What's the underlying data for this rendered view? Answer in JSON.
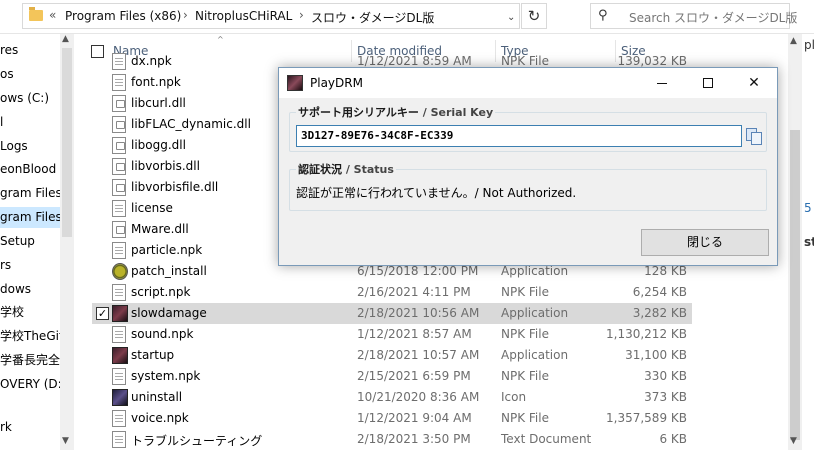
{
  "address": {
    "crumbs": [
      "Program Files (x86)",
      "NitroplusCHiRAL",
      "スロウ・ダメージDL版"
    ],
    "overflow": "«",
    "search_placeholder": "Search スロウ・ダメージDL版"
  },
  "nav": {
    "items": [
      "res",
      "os",
      "ows (C:)",
      "l",
      "Logs",
      "eonBlood",
      "gram Files",
      "gram Files (",
      "Setup",
      "rs",
      "dows",
      "学校",
      "学校TheGift",
      "学番長完全",
      "OVERY (D:)",
      "",
      "rk"
    ]
  },
  "columns": {
    "name": "Name",
    "date": "Date modified",
    "type": "Type",
    "size": "Size"
  },
  "files": [
    {
      "name": "dx.npk",
      "date": "1/12/2021 8:59 AM",
      "type": "NPK File",
      "size": "139,032 KB",
      "icon": "npk-icon",
      "checked": false
    },
    {
      "name": "font.npk",
      "date": "",
      "type": "",
      "size": "",
      "icon": "npk-icon",
      "checked": false
    },
    {
      "name": "libcurl.dll",
      "date": "",
      "type": "",
      "size": "",
      "icon": "dll-icon",
      "checked": false
    },
    {
      "name": "libFLAC_dynamic.dll",
      "date": "",
      "type": "",
      "size": "",
      "icon": "dll-icon",
      "checked": false
    },
    {
      "name": "libogg.dll",
      "date": "",
      "type": "",
      "size": "",
      "icon": "dll-icon",
      "checked": false
    },
    {
      "name": "libvorbis.dll",
      "date": "",
      "type": "",
      "size": "",
      "icon": "dll-icon",
      "checked": false
    },
    {
      "name": "libvorbisfile.dll",
      "date": "",
      "type": "",
      "size": "",
      "icon": "dll-icon",
      "checked": false
    },
    {
      "name": "license",
      "date": "",
      "type": "",
      "size": "",
      "icon": "text-file-icon",
      "checked": false
    },
    {
      "name": "Mware.dll",
      "date": "",
      "type": "",
      "size": "",
      "icon": "dll-icon",
      "checked": false
    },
    {
      "name": "particle.npk",
      "date": "",
      "type": "",
      "size": "",
      "icon": "npk-icon",
      "checked": false
    },
    {
      "name": "patch_install",
      "date": "6/15/2018 12:00 PM",
      "type": "Application",
      "size": "128 KB",
      "icon": "patch-app-icon",
      "checked": false
    },
    {
      "name": "script.npk",
      "date": "2/16/2021 4:11 PM",
      "type": "NPK File",
      "size": "6,254 KB",
      "icon": "npk-icon",
      "checked": false
    },
    {
      "name": "slowdamage",
      "date": "2/18/2021 10:56 AM",
      "type": "Application",
      "size": "3,282 KB",
      "icon": "game-app-icon",
      "checked": true
    },
    {
      "name": "sound.npk",
      "date": "1/12/2021 8:57 AM",
      "type": "NPK File",
      "size": "1,130,212 KB",
      "icon": "npk-icon",
      "checked": false
    },
    {
      "name": "startup",
      "date": "2/18/2021 10:57 AM",
      "type": "Application",
      "size": "31,100 KB",
      "icon": "game-app-icon",
      "checked": false
    },
    {
      "name": "system.npk",
      "date": "2/15/2021 6:59 PM",
      "type": "NPK File",
      "size": "330 KB",
      "icon": "npk-icon",
      "checked": false
    },
    {
      "name": "uninstall",
      "date": "10/21/2020 8:36 AM",
      "type": "Icon",
      "size": "373 KB",
      "icon": "uninstall-icon",
      "checked": false
    },
    {
      "name": "voice.npk",
      "date": "1/12/2021 9:04 AM",
      "type": "NPK File",
      "size": "1,357,589 KB",
      "icon": "npk-icon",
      "checked": false
    },
    {
      "name": "トラブルシューティング",
      "date": "2/18/2021 3:50 PM",
      "type": "Text Document",
      "size": "6 KB",
      "icon": "text-file-icon",
      "checked": false
    }
  ],
  "right_edge": {
    "texts": [
      "pla",
      "5",
      "st"
    ]
  },
  "dialog": {
    "title": "PlayDRM",
    "serial_group_jp": "サポート用シリアルキー",
    "serial_group_en": " / Serial Key",
    "serial_value": "3D127-89E76-34C8F-EC339",
    "status_group_jp": "認証状況",
    "status_group_en": " / Status",
    "status_text": "認証が正常に行われていません。/ Not Authorized.",
    "close_label": "閉じる"
  }
}
